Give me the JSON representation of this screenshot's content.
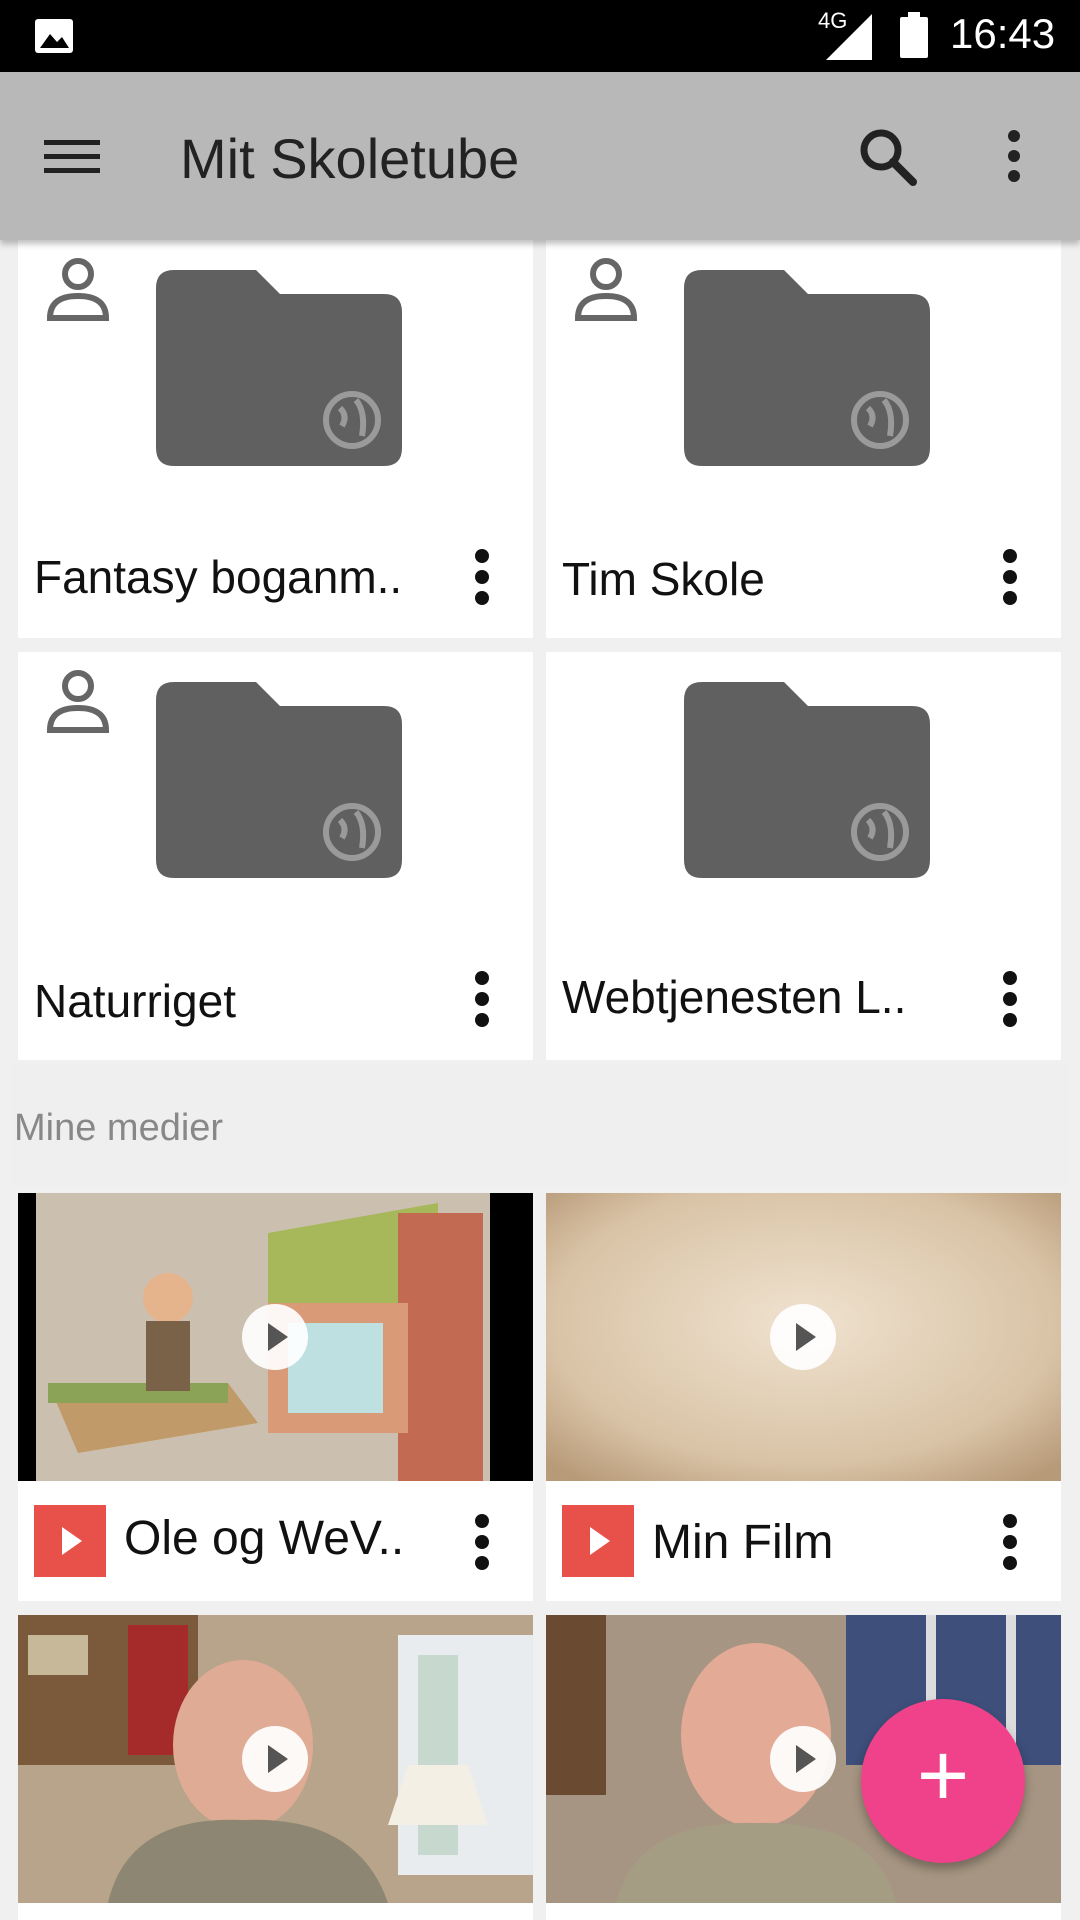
{
  "status_bar": {
    "network": "4G",
    "time": "16:43",
    "icons": [
      "gallery-icon",
      "signal-icon",
      "battery-icon"
    ]
  },
  "app_bar": {
    "title": "Mit Skoletube",
    "icons": [
      "menu-icon",
      "search-icon",
      "more-vert-icon"
    ]
  },
  "folders": [
    {
      "title": "Fantasy boganm..",
      "owner_icon": true,
      "icon": "folder-public-icon"
    },
    {
      "title": "Tim Skole",
      "owner_icon": true,
      "icon": "folder-public-icon"
    },
    {
      "title": "Naturriget",
      "owner_icon": true,
      "icon": "folder-public-icon"
    },
    {
      "title": "Webtjenesten L..",
      "owner_icon": false,
      "icon": "folder-public-icon"
    }
  ],
  "media_section": {
    "title": "Mine medier"
  },
  "media": [
    {
      "title": "Ole og WeV..",
      "type_icon": "video-icon"
    },
    {
      "title": "Min Film",
      "type_icon": "video-icon"
    },
    {
      "title": "",
      "type_icon": "video-icon"
    },
    {
      "title": "",
      "type_icon": "video-icon"
    }
  ],
  "fab": {
    "label": "+"
  },
  "colors": {
    "app_bar": "#b8b8b8",
    "folder": "#606060",
    "badge": "#e8514a",
    "fab": "#f0428a"
  }
}
